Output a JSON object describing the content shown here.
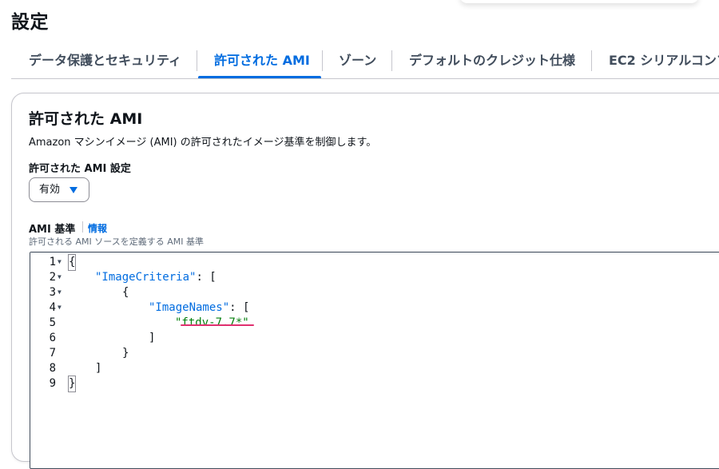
{
  "page": {
    "title": "設定"
  },
  "tabs": [
    {
      "label": "データ保護とセキュリティ",
      "active": false
    },
    {
      "label": "許可された AMI",
      "active": true
    },
    {
      "label": "ゾーン",
      "active": false
    },
    {
      "label": "デフォルトのクレジット仕様",
      "active": false
    },
    {
      "label": "EC2 シリアルコンソ",
      "active": false
    }
  ],
  "panel": {
    "title": "許可された AMI",
    "description": "Amazon マシンイメージ (AMI) の許可されたイメージ基準を制御します。",
    "setting_label": "許可された AMI 設定",
    "setting_value": "有効",
    "criteria_label": "AMI 基準",
    "info_link": "情報",
    "criteria_description": "許可される AMI ソースを定義する AMI 基準"
  },
  "editor": {
    "lines": [
      {
        "num": "1",
        "fold": true,
        "text": "{"
      },
      {
        "num": "2",
        "fold": true,
        "key": "\"ImageCriteria\"",
        "rest": ": ["
      },
      {
        "num": "3",
        "fold": true,
        "text": "{"
      },
      {
        "num": "4",
        "fold": true,
        "key": "\"ImageNames\"",
        "rest": ": ["
      },
      {
        "num": "5",
        "fold": false,
        "value": "\"ftdv-7.7*\""
      },
      {
        "num": "6",
        "fold": false,
        "text": "]"
      },
      {
        "num": "7",
        "fold": false,
        "text": "}"
      },
      {
        "num": "8",
        "fold": false,
        "text": "]"
      },
      {
        "num": "9",
        "fold": false,
        "text": "}"
      }
    ]
  },
  "colors": {
    "accent": "#006ce0",
    "string_value": "#037f0c",
    "highlight_underline": "#e0306f"
  }
}
